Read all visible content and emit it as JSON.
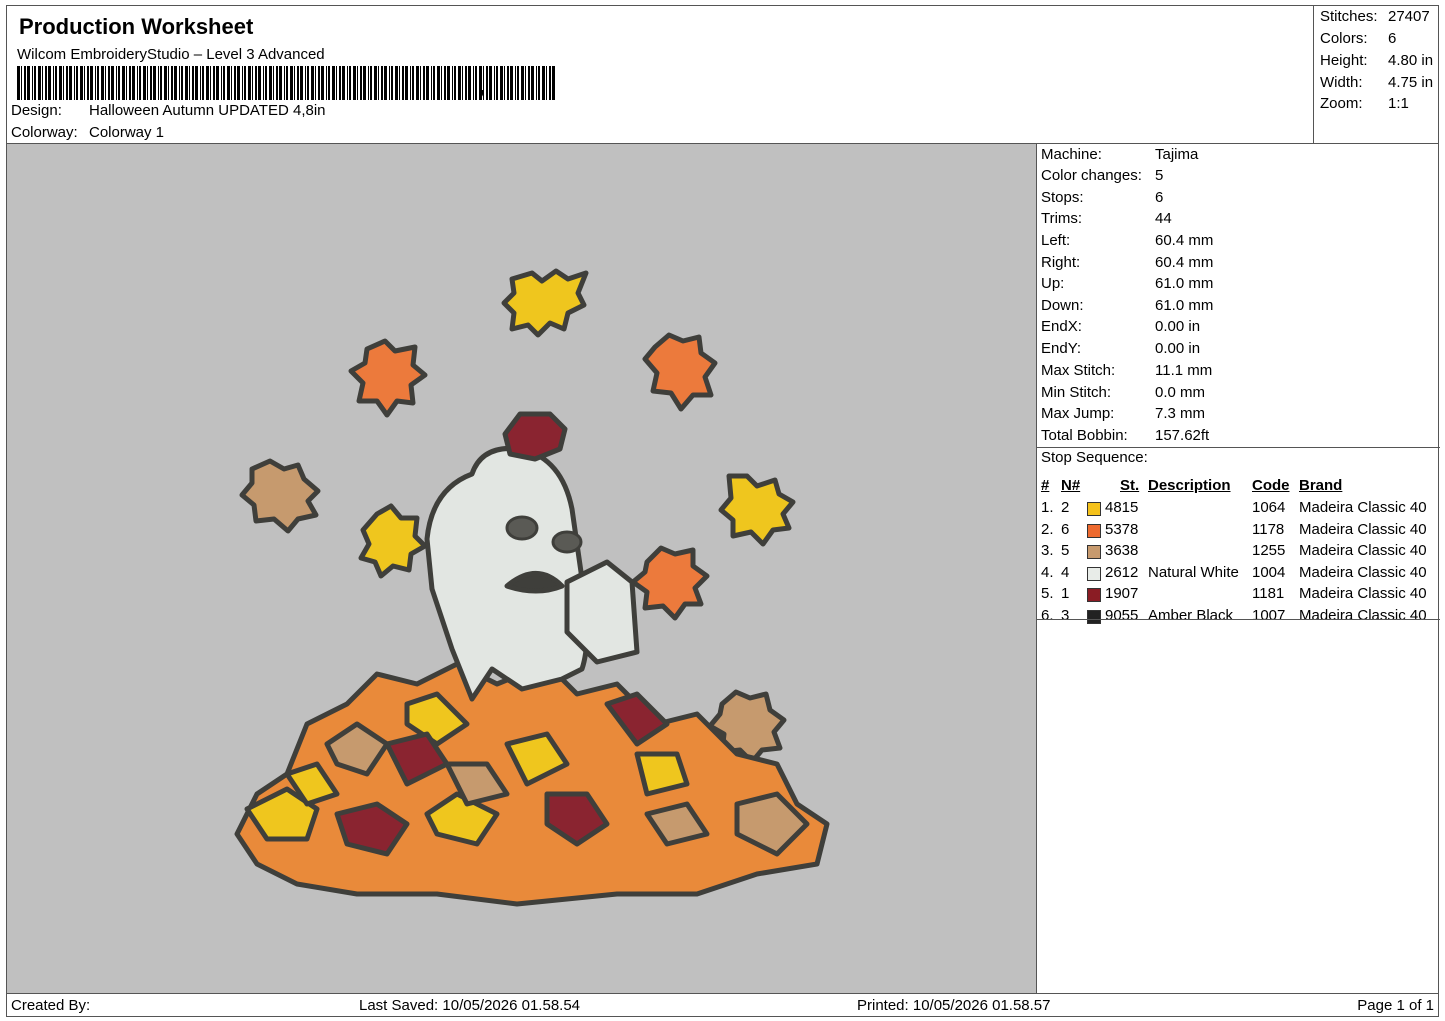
{
  "header": {
    "title": "Production Worksheet",
    "software": "Wilcom EmbroideryStudio – Level 3 Advanced",
    "barcode_suffix": ",",
    "design_label": "Design:",
    "design_value": "Halloween Autumn UPDATED 4,8in",
    "colorway_label": "Colorway:",
    "colorway_value": "Colorway 1"
  },
  "stats": [
    {
      "label": "Stitches:",
      "value": "27407"
    },
    {
      "label": "Colors:",
      "value": "6"
    },
    {
      "label": "Height:",
      "value": "4.80 in"
    },
    {
      "label": "Width:",
      "value": "4.75 in"
    },
    {
      "label": "Zoom:",
      "value": "1:1"
    }
  ],
  "machine": [
    {
      "label": "Machine:",
      "value": "Tajima"
    },
    {
      "label": "Color changes:",
      "value": "5"
    },
    {
      "label": "Stops:",
      "value": "6"
    },
    {
      "label": "Trims:",
      "value": "44"
    },
    {
      "label": "Left:",
      "value": "60.4 mm"
    },
    {
      "label": "Right:",
      "value": "60.4 mm"
    },
    {
      "label": "Up:",
      "value": "61.0 mm"
    },
    {
      "label": "Down:",
      "value": "61.0 mm"
    },
    {
      "label": "EndX:",
      "value": "0.00 in"
    },
    {
      "label": "EndY:",
      "value": "0.00 in"
    },
    {
      "label": "Max Stitch:",
      "value": "11.1 mm"
    },
    {
      "label": "Min Stitch:",
      "value": "0.0 mm"
    },
    {
      "label": "Max Jump:",
      "value": "7.3 mm"
    },
    {
      "label": "Total Bobbin:",
      "value": "157.62ft"
    }
  ],
  "stop_sequence": {
    "title": "Stop Sequence:",
    "headers": {
      "num": "#",
      "n": "N#",
      "st": "St.",
      "desc": "Description",
      "code": "Code",
      "brand": "Brand"
    },
    "rows": [
      {
        "num": "1.",
        "n": "2",
        "color": "#f5c21b",
        "st": "4815",
        "desc": "",
        "code": "1064",
        "brand": "Madeira Classic 40"
      },
      {
        "num": "2.",
        "n": "6",
        "color": "#ee6a2f",
        "st": "5378",
        "desc": "",
        "code": "1178",
        "brand": "Madeira Classic 40"
      },
      {
        "num": "3.",
        "n": "5",
        "color": "#c79a6e",
        "st": "3638",
        "desc": "",
        "code": "1255",
        "brand": "Madeira Classic 40"
      },
      {
        "num": "4.",
        "n": "4",
        "color": "#e8ece8",
        "st": "2612",
        "desc": "Natural White",
        "code": "1004",
        "brand": "Madeira Classic 40"
      },
      {
        "num": "5.",
        "n": "1",
        "color": "#8a1c24",
        "st": "1907",
        "desc": "",
        "code": "1181",
        "brand": "Madeira Classic 40"
      },
      {
        "num": "6.",
        "n": "3",
        "color": "#222222",
        "st": "9055",
        "desc": "Amber Black",
        "code": "1007",
        "brand": "Madeira Classic 40"
      }
    ]
  },
  "footer": {
    "created_by": "Created By:",
    "last_saved": "Last Saved: 10/05/2026 01.58.54",
    "printed": "Printed: 10/05/2026 01.58.57",
    "page": "Page 1 of 1"
  }
}
